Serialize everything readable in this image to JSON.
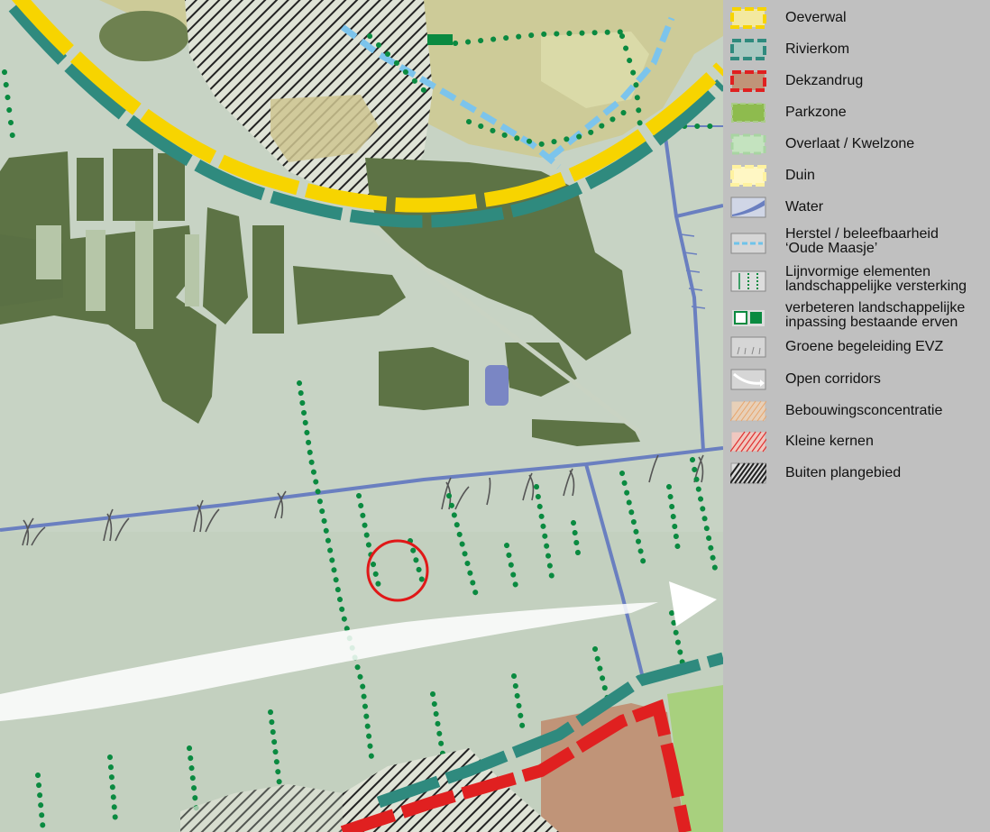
{
  "legend": {
    "items": [
      {
        "key": "oeverwal",
        "lines": [
          "Oeverwal"
        ],
        "icon": "dashed-rect-yellow",
        "color": "#f7d400"
      },
      {
        "key": "rivierkom",
        "lines": [
          "Rivierkom"
        ],
        "icon": "dashed-rect-teal",
        "color": "#2f8a7e"
      },
      {
        "key": "dekzandrug",
        "lines": [
          "Dekzandrug"
        ],
        "icon": "dashed-rect-red-brown",
        "color": "#e02020"
      },
      {
        "key": "parkzone",
        "lines": [
          "Parkzone"
        ],
        "icon": "filled-rect-green",
        "color": "#8ebb4e"
      },
      {
        "key": "overlaat",
        "lines": [
          "Overlaat / Kwelzone"
        ],
        "icon": "dashed-rect-lightgreen",
        "color": "#a8d5a2"
      },
      {
        "key": "duin",
        "lines": [
          "Duin"
        ],
        "icon": "dashed-rect-paleyellow",
        "color": "#fff2a0"
      },
      {
        "key": "water",
        "lines": [
          "Water"
        ],
        "icon": "water-curve",
        "color": "#6a7fc0"
      },
      {
        "key": "herstel",
        "lines": [
          "Herstel / beleefbaarheid",
          "‘Oude Maasje’"
        ],
        "icon": "dashed-blue-line",
        "color": "#6fc3ea"
      },
      {
        "key": "lijnvormige",
        "lines": [
          "Lijnvormige elementen",
          "landschappelijke versterking"
        ],
        "icon": "dotted-green-lines",
        "color": "#0a8a40"
      },
      {
        "key": "verbeteren",
        "lines": [
          "verbeteren landschappelijke",
          "inpassing bestaande erven"
        ],
        "icon": "green-squares",
        "color": "#0a8a40"
      },
      {
        "key": "groene",
        "lines": [
          "Groene begeleiding EVZ"
        ],
        "icon": "grass-tufts",
        "color": "#888888"
      },
      {
        "key": "open",
        "lines": [
          "Open corridors"
        ],
        "icon": "white-arrow",
        "color": "#ffffff"
      },
      {
        "key": "bebouwing",
        "lines": [
          "Bebouwingsconcentratie"
        ],
        "icon": "hatch-orange",
        "color": "#e8a46a"
      },
      {
        "key": "kleine",
        "lines": [
          "Kleine kernen"
        ],
        "icon": "hatch-red",
        "color": "#e03030"
      },
      {
        "key": "buiten",
        "lines": [
          "Buiten plangebied"
        ],
        "icon": "hatch-black",
        "color": "#222222"
      }
    ]
  },
  "map": {
    "colors": {
      "background": "#c7d3c4",
      "dark_green": "#5e7446",
      "light_field": "#b3c3a5",
      "khaki": "#c9c890",
      "yellow": "#f7d400",
      "teal": "#2f8a7e",
      "red": "#e02020",
      "brown": "#c09478",
      "water_blue": "#6a7fc0",
      "light_blue": "#7cc4ec",
      "green_dot": "#0a8a40",
      "park_green": "#a8d07e",
      "marker_red": "#e01818"
    }
  }
}
